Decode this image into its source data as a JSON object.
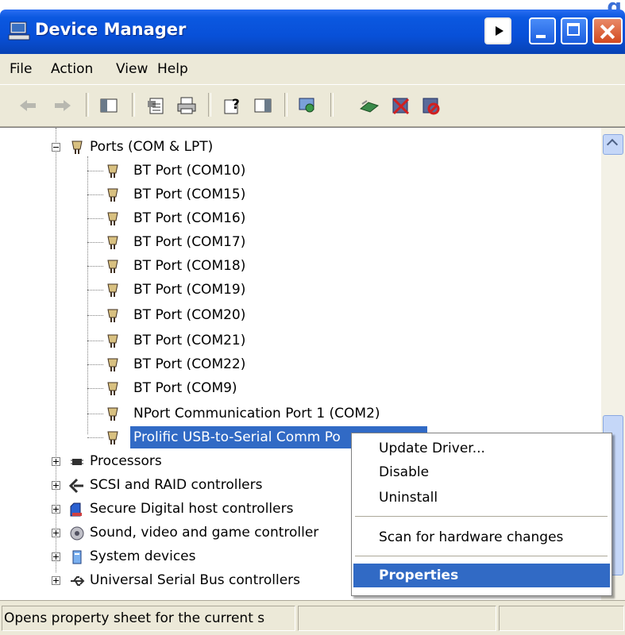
{
  "window": {
    "title": "Device Manager",
    "corner_glyph": "g"
  },
  "menubar": {
    "items": [
      "File",
      "Action",
      "View",
      "Help"
    ]
  },
  "toolbar": {
    "icons": [
      "back-icon",
      "forward-icon",
      "show-hide-console-tree-icon",
      "properties-icon",
      "print-icon",
      "help-icon",
      "show-hide-action-pane-icon",
      "scan-hardware-icon",
      "update-driver-icon",
      "uninstall-icon",
      "disable-icon"
    ]
  },
  "tree": {
    "ports_category": "Ports (COM & LPT)",
    "ports": [
      "BT Port (COM10)",
      "BT Port (COM15)",
      "BT Port (COM16)",
      "BT Port (COM17)",
      "BT Port (COM18)",
      "BT Port (COM19)",
      "BT Port (COM20)",
      "BT Port (COM21)",
      "BT Port (COM22)",
      "BT Port (COM9)",
      "NPort Communication Port 1 (COM2)",
      "Prolific USB-to-Serial Comm Po"
    ],
    "categories": [
      "Processors",
      "SCSI and RAID controllers",
      "Secure Digital host controllers",
      "Sound, video and game controller",
      "System devices",
      "Universal Serial Bus controllers"
    ]
  },
  "context_menu": {
    "update_driver": "Update Driver...",
    "disable": "Disable",
    "uninstall": "Uninstall",
    "scan": "Scan for hardware changes",
    "properties": "Properties"
  },
  "statusbar": {
    "text": "Opens property sheet for the current s"
  },
  "colors": {
    "titlebar": "#0850d8",
    "selection": "#316ac5",
    "chrome": "#ece9d8"
  }
}
